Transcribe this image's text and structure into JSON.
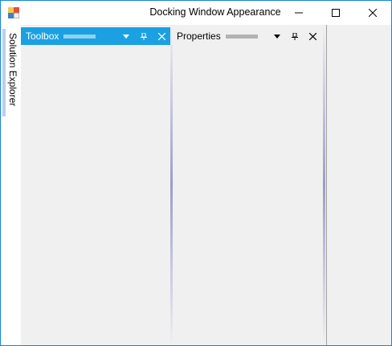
{
  "window": {
    "title": "Docking Window Appearance"
  },
  "autohide": {
    "tab_label": "Solution Explorer"
  },
  "panes": {
    "toolbox": {
      "caption": "Toolbox"
    },
    "properties": {
      "caption": "Properties"
    }
  },
  "icons": {
    "app": "app-icon",
    "minimize": "minimize-icon",
    "maximize": "maximize-icon",
    "close": "close-icon",
    "dropdown": "dropdown-arrow-icon",
    "pin": "pin-icon",
    "pane_close": "close-icon"
  },
  "colors": {
    "active_caption": "#1ba1e2",
    "window_border": "#1883d7",
    "autohide_tab": "#b9cff0",
    "client_background": "#f0f0f0"
  }
}
